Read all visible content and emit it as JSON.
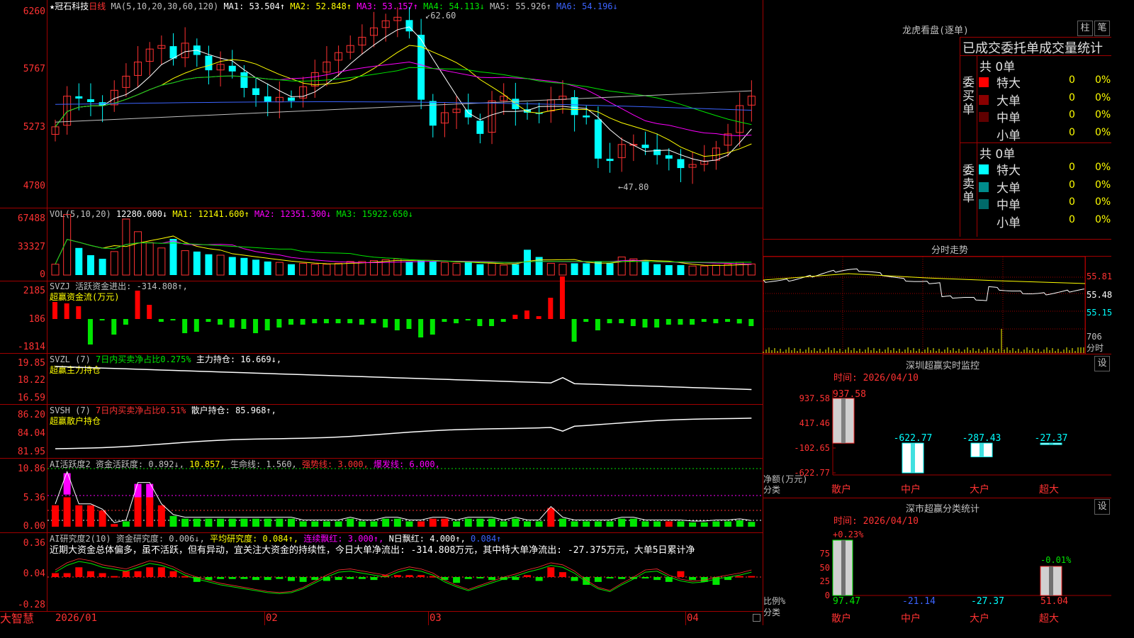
{
  "main": {
    "title": "★冠石科技",
    "period": "日线",
    "ma_header": "MA(5,10,20,30,60,120)",
    "ma": [
      {
        "label": "MA1: 53.504↑",
        "color": "#ffffff"
      },
      {
        "label": "MA2: 52.848↑",
        "color": "#ffff00"
      },
      {
        "label": "MA3: 53.157↑",
        "color": "#ff00ff"
      },
      {
        "label": "MA4: 54.113↓",
        "color": "#00e600"
      },
      {
        "label": "MA5: 55.926↑",
        "color": "#c0c0c0"
      },
      {
        "label": "MA6: 54.196↓",
        "color": "#3c64ff"
      }
    ],
    "y_ticks": [
      "6260",
      "5767",
      "5273",
      "4780"
    ],
    "high_label": "62.60",
    "low_label": "47.80"
  },
  "vol": {
    "header": "VOL(5,10,20)",
    "value": "12280.000↓",
    "ma": [
      {
        "label": "MA1: 12141.600↑",
        "color": "#ffff00"
      },
      {
        "label": "MA2: 12351.300↓",
        "color": "#ff00ff"
      },
      {
        "label": "MA3: 15922.650↓",
        "color": "#00e600"
      }
    ],
    "y_ticks": [
      "67488",
      "33327",
      "0"
    ]
  },
  "svzj": {
    "header": "SVZJ  活跃资金进出: -314.808↑,",
    "subtitle": "超赢资金流(万元)",
    "y_ticks": [
      "2185",
      "186",
      "-1814"
    ]
  },
  "svzl": {
    "header": "SVZL (7)",
    "ratio": "7日内买卖净占比0.275%",
    "hold": "主力持仓: 16.669↓,",
    "subtitle": "超赢主力持仓",
    "y_ticks": [
      "19.85",
      "18.22",
      "16.59"
    ]
  },
  "svsh": {
    "header": "SVSH (7)",
    "ratio": "7日内买卖净占比0.51%",
    "hold": "散户持仓: 85.968↑,",
    "subtitle": "超赢散户持仓",
    "y_ticks": [
      "86.20",
      "84.04",
      "81.95"
    ]
  },
  "ai1": {
    "header": "AI活跃度2",
    "items": [
      {
        "label": "资金活跃度: 0.892↓,",
        "color": "#c0c0c0"
      },
      {
        "label": "10.857,",
        "color": "#ffff00"
      },
      {
        "label": "生命线: 1.560,",
        "color": "#c0c0c0"
      },
      {
        "label": "强势线: 3.000,",
        "color": "#ff3232"
      },
      {
        "label": "爆发线: 6.000,",
        "color": "#ff00ff"
      }
    ],
    "y_ticks": [
      "10.86",
      "5.36",
      "0.00"
    ]
  },
  "ai2": {
    "header": "AI研究度2(10)",
    "items": [
      {
        "label": "资金研究度: 0.006↓,",
        "color": "#c0c0c0"
      },
      {
        "label": "平均研究度: 0.084↑,",
        "color": "#ffff00"
      },
      {
        "label": "连续飘红: 3.000↑,",
        "color": "#ff00ff"
      },
      {
        "label": "N日飘红: 4.000↑,",
        "color": "#ffffff"
      },
      {
        "label": "0.084↑",
        "color": "#3c64ff"
      }
    ],
    "commentary": "近期大资金总体偏多，虽不活跃，但有异动，宜关注大资金的持续性，今日大单净流出: -314.808万元，其中特大单净流出: -27.375万元，大单5日累计净",
    "y_ticks": [
      "0.36",
      "0.04",
      "-0.28"
    ]
  },
  "x_axis": {
    "labels": [
      "2026/01",
      "02",
      "03",
      "04"
    ]
  },
  "brand": "大智慧",
  "side": {
    "dragon_title": "龙虎看盘(逐单)",
    "btn_bar": "柱",
    "btn_pen": "笔",
    "tabs": "已成交委托单成交量统计",
    "buy_label": "委买单",
    "sell_label": "委卖单",
    "buy_total": "共 0单",
    "sell_total": "共 0单",
    "buy_rows": [
      {
        "name": "特大",
        "count": "0",
        "pct": "0%",
        "color": "#ff0000"
      },
      {
        "name": "大单",
        "count": "0",
        "pct": "0%",
        "color": "#8b0000"
      },
      {
        "name": "中单",
        "count": "0",
        "pct": "0%",
        "color": "#600000"
      },
      {
        "name": "小单",
        "count": "0",
        "pct": "0%",
        "color": "#000000"
      }
    ],
    "sell_rows": [
      {
        "name": "特大",
        "count": "0",
        "pct": "0%",
        "color": "#00ffff"
      },
      {
        "name": "大单",
        "count": "0",
        "pct": "0%",
        "color": "#008b8b"
      },
      {
        "name": "中单",
        "count": "0",
        "pct": "0%",
        "color": "#006a6a"
      },
      {
        "name": "小单",
        "count": "0",
        "pct": "0%",
        "color": "#000000"
      }
    ],
    "intraday_title": "分时走势",
    "intraday_prices": [
      "55.81",
      "55.48",
      "55.15"
    ],
    "intraday_vol": "706",
    "intraday_unit": "分时",
    "monitor_title": "深圳超赢实时监控",
    "monitor_time": "时间: 2026/04/10",
    "monitor_y": [
      "937.58",
      "417.46",
      "-102.65",
      "-622.77"
    ],
    "monitor_ylabel": "净额(万元)",
    "monitor_xlabel": "分类",
    "monitor_cats": [
      "散户",
      "中户",
      "大户",
      "超大"
    ],
    "monitor_values": [
      "937.58",
      "-622.77",
      "-287.43",
      "-27.37"
    ],
    "stat_title": "深市超赢分类统计",
    "stat_time": "时间: 2026/04/10",
    "stat_top": [
      "+0.23%",
      "-0.01%"
    ],
    "stat_y": [
      "75",
      "50",
      "25",
      "0"
    ],
    "stat_ylabel": "比例%",
    "stat_xlabel": "分类",
    "stat_vals": [
      "97.47",
      "-21.14",
      "-27.37",
      "51.04"
    ],
    "stat_cats": [
      "散户",
      "中户",
      "大户",
      "超大"
    ],
    "settings_btn": "设"
  },
  "chart_data": [
    {
      "type": "candlestick",
      "title": "冠石科技 日线",
      "ylim": [
        47.8,
        62.6
      ],
      "close": [
        52.8,
        55.4,
        55.2,
        54.9,
        54.6,
        55.9,
        57.1,
        58.3,
        59.4,
        59.7,
        58.6,
        59.9,
        58.9,
        57.6,
        58.1,
        57.5,
        56.1,
        55.5,
        54.9,
        55.3,
        55.0,
        56.2,
        57.4,
        58.3,
        59.1,
        59.7,
        60.4,
        61.2,
        61.8,
        62.1,
        60.9,
        55.1,
        52.9,
        54.0,
        54.3,
        53.6,
        52.2,
        55.0,
        55.4,
        54.3,
        54.0,
        53.9,
        55.1,
        55.4,
        53.8,
        53.6,
        50.1,
        49.9,
        51.3,
        51.3,
        51.0,
        50.4,
        50.1,
        49.3,
        49.6,
        49.9,
        51.0,
        52.2,
        54.6,
        55.4
      ]
    },
    {
      "type": "bar",
      "title": "VOL(5,10,20)",
      "ylim": [
        0,
        67488
      ],
      "values": [
        12000,
        67000,
        30000,
        22000,
        18000,
        26000,
        62000,
        48000,
        36000,
        30000,
        40000,
        27000,
        26000,
        23000,
        22000,
        20000,
        19000,
        17000,
        15000,
        14000,
        12000,
        13000,
        12000,
        12000,
        13000,
        15000,
        15000,
        16000,
        17000,
        18000,
        15000,
        16000,
        15000,
        14000,
        13000,
        14000,
        12000,
        13000,
        11000,
        12000,
        28000,
        20000,
        13000,
        12000,
        13000,
        13000,
        15000,
        13000,
        20000,
        18000,
        16000,
        12000,
        11000,
        11000,
        10000,
        10000,
        11000,
        12000,
        14000,
        12280
      ]
    },
    {
      "type": "bar",
      "title": "超赢资金流(万元)",
      "ylim": [
        -1814,
        2185
      ],
      "values": [
        1200,
        1100,
        900,
        -1800,
        -100,
        -1100,
        -400,
        2000,
        1000,
        -200,
        -100,
        -1000,
        -900,
        -200,
        -400,
        -600,
        -700,
        -1000,
        -800,
        -600,
        -400,
        -400,
        -300,
        -300,
        -300,
        -300,
        -400,
        -300,
        -600,
        -800,
        -700,
        -1300,
        -1100,
        -200,
        -300,
        -100,
        -500,
        -500,
        -200,
        300,
        600,
        200,
        1500,
        3000,
        -1600,
        -200,
        -800,
        -300,
        -300,
        -500,
        -600,
        -600,
        -400,
        -400,
        -400,
        -200,
        -300,
        -200,
        -314,
        -500
      ]
    }
  ]
}
